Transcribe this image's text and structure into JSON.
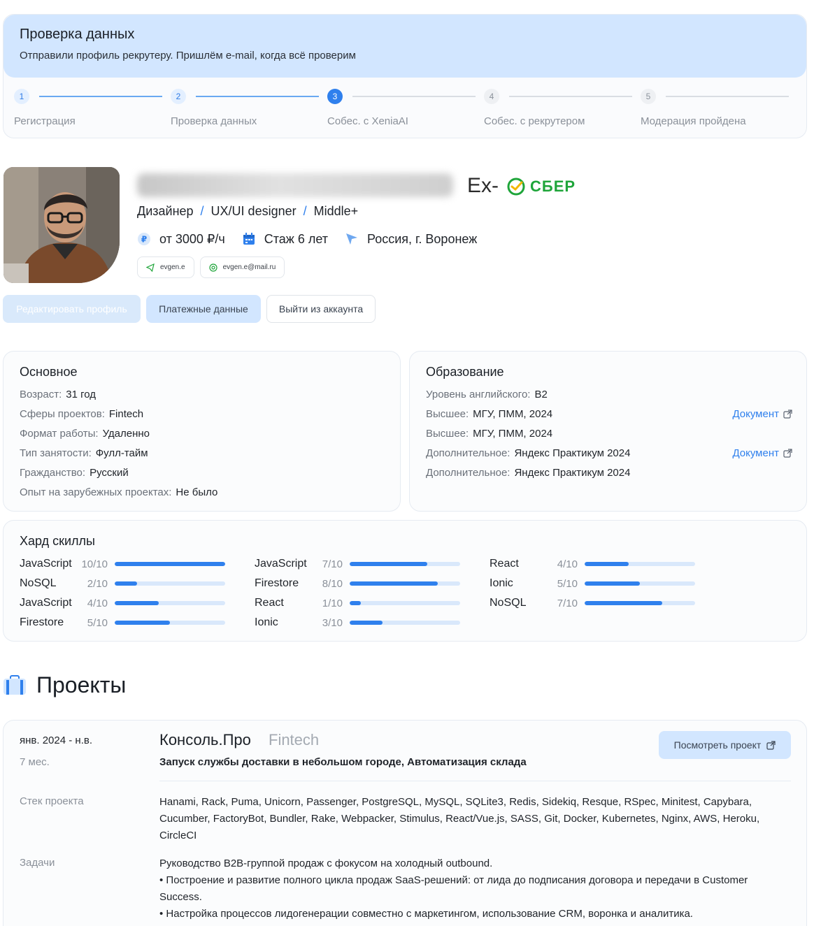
{
  "verify": {
    "title": "Проверка данных",
    "subtitle": "Отправили профиль рекрутеру. Пришлём e-mail, когда всё проверим"
  },
  "steps": [
    {
      "num": "1",
      "label": "Регистрация",
      "state": "done"
    },
    {
      "num": "2",
      "label": "Проверка данных",
      "state": "done"
    },
    {
      "num": "3",
      "label": "Собес. с XeniaAI",
      "state": "active"
    },
    {
      "num": "4",
      "label": "Собес. с рекрутером",
      "state": "todo"
    },
    {
      "num": "5",
      "label": "Модерация пройдена",
      "state": "todo"
    }
  ],
  "profile": {
    "ex_label": "Ex-",
    "company": "СБЕР",
    "role": [
      "Дизайнер",
      "UX/UI designer",
      "Middle+"
    ],
    "role_sep": "/",
    "rate": "от 3000 ₽/ч",
    "experience": "Стаж 6 лет",
    "location": "Россия, г. Воронеж",
    "telegram": "evgen.e",
    "email": "evgen.e@mail.ru"
  },
  "actions": {
    "edit": "Редактировать профиль",
    "payment": "Платежные данные",
    "logout": "Выйти из аккаунта"
  },
  "basic": {
    "title": "Основное",
    "rows": [
      {
        "label": "Возраст:",
        "value": "31 год"
      },
      {
        "label": "Сферы проектов:",
        "value": "Fintech"
      },
      {
        "label": "Формат работы:",
        "value": "Удаленно"
      },
      {
        "label": "Тип занятости:",
        "value": "Фулл-тайм"
      },
      {
        "label": "Гражданство:",
        "value": "Русский"
      },
      {
        "label": "Опыт на зарубежных проектах:",
        "value": "Не было"
      }
    ]
  },
  "education": {
    "title": "Образование",
    "doc_label": "Документ",
    "rows": [
      {
        "label": "Уровень английского:",
        "value": "B2",
        "doc": false
      },
      {
        "label": "Высшее:",
        "value": "МГУ, ПММ, 2024",
        "doc": true
      },
      {
        "label": "Высшее:",
        "value": "МГУ, ПММ, 2024",
        "doc": false
      },
      {
        "label": "Дополнительное:",
        "value": "Яндекс Практикум 2024",
        "doc": true
      },
      {
        "label": "Дополнительное:",
        "value": "Яндекс Практикум 2024",
        "doc": false
      }
    ]
  },
  "skills": {
    "title": "Хард скиллы",
    "columns": [
      [
        {
          "name": "JavaScript",
          "score": "10/10",
          "level": 10
        },
        {
          "name": "NoSQL",
          "score": "2/10",
          "level": 2
        },
        {
          "name": "JavaScript",
          "score": "4/10",
          "level": 4
        },
        {
          "name": "Firestore",
          "score": "5/10",
          "level": 5
        }
      ],
      [
        {
          "name": "JavaScript",
          "score": "7/10",
          "level": 7
        },
        {
          "name": "Firestore",
          "score": "8/10",
          "level": 8
        },
        {
          "name": "React",
          "score": "1/10",
          "level": 1
        },
        {
          "name": "Ionic",
          "score": "3/10",
          "level": 3
        }
      ],
      [
        {
          "name": "React",
          "score": "4/10",
          "level": 4
        },
        {
          "name": "Ionic",
          "score": "5/10",
          "level": 5
        },
        {
          "name": "NoSQL",
          "score": "7/10",
          "level": 7
        }
      ]
    ]
  },
  "projects": {
    "title": "Проекты",
    "items": [
      {
        "period": "янв. 2024 - н.в.",
        "duration": "7 мес.",
        "name": "Консоль.Про",
        "sphere": "Fintech",
        "description": "Запуск службы доставки в небольшом городе, Автоматизация склада",
        "view_label": "Посмотреть проект",
        "stack_label": "Стек проекта",
        "stack": "Hanami, Rack, Puma, Unicorn, Passenger, PostgreSQL, MySQL, SQLite3, Redis, Sidekiq, Resque, RSpec, Minitest, Capybara, Cucumber, FactoryBot, Bundler, Rake, Webpacker, Stimulus, React/Vue.js, SASS, Git, Docker, Kubernetes, Nginx, AWS, Heroku, CircleCI",
        "tasks_label": "Задачи",
        "tasks": [
          "Руководство B2B-группой продаж с фокусом на холодный outbound.",
          "• Построение и развитие полного цикла продаж SaaS-решений: от лида до подписания договора и передачи в Customer Success.",
          "• Настройка процессов лидогенерации совместно с маркетингом, использование CRM, воронка и аналитика."
        ]
      }
    ]
  },
  "colors": {
    "accent": "#2f80ed",
    "banner": "#d2e6ff",
    "sber": "#1fa53a"
  }
}
